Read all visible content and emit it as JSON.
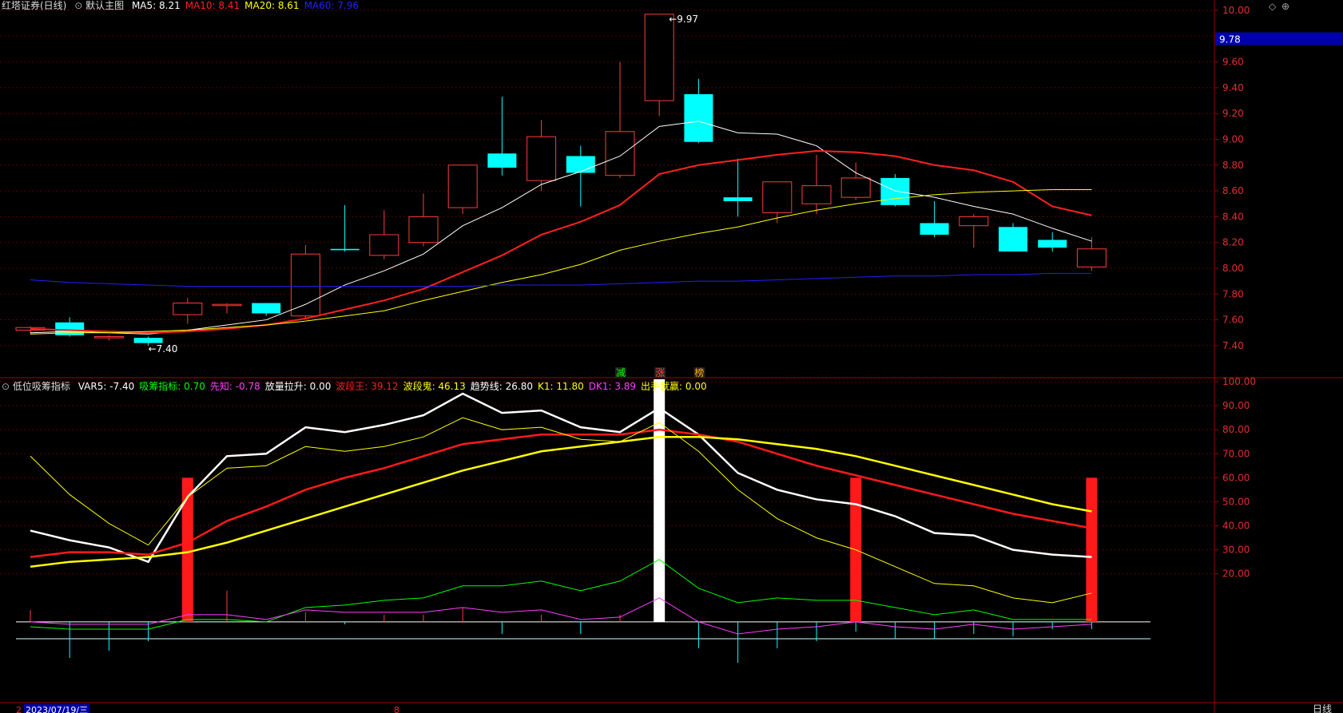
{
  "colors": {
    "up": "#ff3b3b",
    "down": "#00ffff",
    "ma5": "#ffffff",
    "ma10": "#ff2020",
    "ma20": "#ffff00",
    "ma60": "#2020ff",
    "axis": "#a00000",
    "grid": "#5a0000"
  },
  "header": {
    "stock": "红塔证券(日线)",
    "view": "默认主图",
    "ma": [
      {
        "label": "MA5: 8.21",
        "color": "#ffffff"
      },
      {
        "label": "MA10: 8.41",
        "color": "#ff2020"
      },
      {
        "label": "MA20: 8.61",
        "color": "#ffff00"
      },
      {
        "label": "MA60: 7.96",
        "color": "#2020ff"
      }
    ]
  },
  "indicator_header": {
    "name": "低位吸筹指标",
    "items": [
      {
        "label": "VAR5: -7.40",
        "color": "#ffffff"
      },
      {
        "label": "吸筹指标: 0.70",
        "color": "#00ff00"
      },
      {
        "label": "先知: -0.78",
        "color": "#ff40ff"
      },
      {
        "label": "放量拉升: 0.00",
        "color": "#ffffff"
      },
      {
        "label": "波段王: 39.12",
        "color": "#ff2020"
      },
      {
        "label": "波段鬼: 46.13",
        "color": "#ffff00"
      },
      {
        "label": "趋势线: 26.80",
        "color": "#ffffff"
      },
      {
        "label": "K1: 11.80",
        "color": "#ffff00"
      },
      {
        "label": "DK1: 3.89",
        "color": "#ff40ff"
      },
      {
        "label": "出手就赢: 0.00",
        "color": "#ffff00"
      }
    ]
  },
  "current_price": "9.78",
  "annotations": {
    "high": "9.97",
    "low": "7.40"
  },
  "signals": [
    {
      "label": "减",
      "color": "#00ff00",
      "index": 15
    },
    {
      "label": "涨",
      "color": "#ff4040",
      "index": 16
    },
    {
      "label": "榜",
      "color": "#ffaa00",
      "index": 17
    }
  ],
  "footer": {
    "date": "2023/07/19/三",
    "left_mark": "2",
    "mid_mark": "8",
    "period": "日线"
  },
  "chart_data": [
    {
      "type": "candlestick",
      "title": "",
      "ylim": [
        7.3,
        10.0
      ],
      "y_ticks": [
        "10.00",
        "9.80",
        "9.60",
        "9.40",
        "9.20",
        "9.00",
        "8.80",
        "8.60",
        "8.40",
        "8.20",
        "8.00",
        "7.80",
        "7.60",
        "7.40"
      ],
      "candles": [
        {
          "o": 7.52,
          "h": 7.55,
          "l": 7.49,
          "c": 7.54
        },
        {
          "o": 7.58,
          "h": 7.62,
          "l": 7.47,
          "c": 7.48
        },
        {
          "o": 7.46,
          "h": 7.48,
          "l": 7.44,
          "c": 7.47
        },
        {
          "o": 7.46,
          "h": 7.47,
          "l": 7.4,
          "c": 7.42
        },
        {
          "o": 7.64,
          "h": 7.77,
          "l": 7.57,
          "c": 7.73
        },
        {
          "o": 7.71,
          "h": 7.73,
          "l": 7.65,
          "c": 7.72
        },
        {
          "o": 7.73,
          "h": 7.73,
          "l": 7.63,
          "c": 7.65
        },
        {
          "o": 7.63,
          "h": 8.18,
          "l": 7.61,
          "c": 8.11
        },
        {
          "o": 8.15,
          "h": 8.49,
          "l": 8.13,
          "c": 8.14
        },
        {
          "o": 8.1,
          "h": 8.45,
          "l": 8.07,
          "c": 8.26
        },
        {
          "o": 8.2,
          "h": 8.58,
          "l": 8.17,
          "c": 8.4
        },
        {
          "o": 8.47,
          "h": 8.8,
          "l": 8.42,
          "c": 8.8
        },
        {
          "o": 8.89,
          "h": 9.33,
          "l": 8.72,
          "c": 8.78
        },
        {
          "o": 8.68,
          "h": 9.15,
          "l": 8.6,
          "c": 9.02
        },
        {
          "o": 8.87,
          "h": 8.95,
          "l": 8.48,
          "c": 8.74
        },
        {
          "o": 8.72,
          "h": 9.6,
          "l": 8.7,
          "c": 9.06
        },
        {
          "o": 9.3,
          "h": 9.97,
          "l": 9.18,
          "c": 9.97
        },
        {
          "o": 9.35,
          "h": 9.47,
          "l": 8.97,
          "c": 8.98
        },
        {
          "o": 8.55,
          "h": 8.85,
          "l": 8.4,
          "c": 8.52
        },
        {
          "o": 8.43,
          "h": 8.67,
          "l": 8.35,
          "c": 8.67
        },
        {
          "o": 8.5,
          "h": 8.88,
          "l": 8.42,
          "c": 8.64
        },
        {
          "o": 8.55,
          "h": 8.82,
          "l": 8.53,
          "c": 8.7
        },
        {
          "o": 8.7,
          "h": 8.73,
          "l": 8.48,
          "c": 8.49
        },
        {
          "o": 8.35,
          "h": 8.52,
          "l": 8.24,
          "c": 8.26
        },
        {
          "o": 8.33,
          "h": 8.42,
          "l": 8.16,
          "c": 8.4
        },
        {
          "o": 8.32,
          "h": 8.35,
          "l": 8.13,
          "c": 8.13
        },
        {
          "o": 8.22,
          "h": 8.28,
          "l": 8.13,
          "c": 8.16
        },
        {
          "o": 8.01,
          "h": 8.24,
          "l": 7.98,
          "c": 8.15
        }
      ],
      "series": [
        {
          "name": "MA5",
          "values": [
            7.5,
            7.51,
            7.5,
            7.49,
            7.52,
            7.56,
            7.6,
            7.72,
            7.87,
            7.98,
            8.11,
            8.33,
            8.47,
            8.65,
            8.75,
            8.87,
            9.1,
            9.14,
            9.05,
            9.04,
            8.95,
            8.74,
            8.6,
            8.55,
            8.48,
            8.42,
            8.31,
            8.21
          ]
        },
        {
          "name": "MA10",
          "values": [
            7.53,
            7.52,
            7.51,
            7.5,
            7.51,
            7.53,
            7.56,
            7.61,
            7.68,
            7.75,
            7.84,
            7.97,
            8.1,
            8.26,
            8.36,
            8.49,
            8.73,
            8.8,
            8.84,
            8.88,
            8.91,
            8.9,
            8.87,
            8.8,
            8.76,
            8.67,
            8.48,
            8.41
          ]
        },
        {
          "name": "MA20",
          "values": [
            7.49,
            7.5,
            7.5,
            7.51,
            7.52,
            7.54,
            7.56,
            7.59,
            7.63,
            7.67,
            7.75,
            7.82,
            7.89,
            7.95,
            8.03,
            8.14,
            8.21,
            8.27,
            8.32,
            8.39,
            8.45,
            8.5,
            8.54,
            8.57,
            8.59,
            8.6,
            8.61,
            8.61
          ]
        },
        {
          "name": "MA60",
          "values": [
            7.91,
            7.89,
            7.88,
            7.87,
            7.86,
            7.86,
            7.86,
            7.86,
            7.86,
            7.86,
            7.86,
            7.86,
            7.87,
            7.87,
            7.87,
            7.88,
            7.89,
            7.9,
            7.9,
            7.91,
            7.92,
            7.93,
            7.94,
            7.94,
            7.95,
            7.95,
            7.96,
            7.96
          ]
        }
      ]
    },
    {
      "type": "line",
      "title": "",
      "ylim": [
        -8,
        100
      ],
      "y_ticks": [
        "100.00",
        "90.00",
        "80.00",
        "70.00",
        "60.00",
        "50.00",
        "40.00",
        "30.00",
        "20.00"
      ],
      "series": [
        {
          "name": "趋势线",
          "color": "#ffffff",
          "width": 2.5,
          "values": [
            38,
            34,
            31,
            25,
            52,
            69,
            70,
            81,
            79,
            82,
            86,
            95,
            87,
            88,
            81,
            79,
            89,
            78,
            62,
            55,
            51,
            49,
            44,
            37,
            36,
            30,
            28,
            27
          ]
        },
        {
          "name": "波段王",
          "color": "#ff1a1a",
          "width": 2.5,
          "values": [
            27,
            29,
            29,
            28,
            33,
            42,
            48,
            55,
            60,
            64,
            69,
            74,
            76,
            78,
            78,
            78,
            80,
            78,
            75,
            70,
            65,
            61,
            57,
            53,
            49,
            45,
            42,
            39
          ]
        },
        {
          "name": "波段鬼",
          "color": "#ffff00",
          "width": 2.5,
          "values": [
            23,
            25,
            26,
            27,
            29,
            33,
            38,
            43,
            48,
            53,
            58,
            63,
            67,
            71,
            73,
            75,
            77,
            77,
            76,
            74,
            72,
            69,
            65,
            61,
            57,
            53,
            49,
            46
          ]
        },
        {
          "name": "K1",
          "color": "#ffff00",
          "width": 1,
          "values": [
            69,
            53,
            41,
            32,
            52,
            64,
            65,
            73,
            71,
            73,
            77,
            85,
            80,
            81,
            76,
            75,
            83,
            71,
            55,
            43,
            35,
            30,
            23,
            16,
            15,
            10,
            8,
            12
          ]
        },
        {
          "name": "吸筹指标",
          "color": "#00ff00",
          "width": 1,
          "values": [
            -2,
            -3,
            -3,
            -3,
            1,
            1,
            0,
            6,
            7,
            9,
            10,
            15,
            15,
            17,
            13,
            17,
            26,
            14,
            8,
            10,
            9,
            9,
            6,
            3,
            5,
            1,
            1,
            1
          ]
        },
        {
          "name": "先知",
          "color": "#ff40ff",
          "width": 1,
          "values": [
            0,
            -1,
            -1,
            -1,
            3,
            3,
            1,
            5,
            4,
            4,
            4,
            6,
            4,
            5,
            1,
            2,
            10,
            0,
            -5,
            -3,
            -2,
            0,
            -2,
            -3,
            -1,
            -3,
            -2,
            -1
          ]
        },
        {
          "name": "DK1",
          "color": "#ffffff",
          "width": 1,
          "values": [
            0,
            0,
            0,
            0,
            0,
            0,
            0,
            0,
            0,
            0,
            0,
            0,
            0,
            0,
            0,
            0,
            0,
            0,
            0,
            0,
            0,
            0,
            0,
            0,
            0,
            0,
            0,
            0
          ]
        }
      ],
      "white_bars": [
        {
          "index": 16,
          "top": 101,
          "bottom": 0
        }
      ],
      "red_bars": [
        {
          "index": 4,
          "top": 60,
          "bottom": 0
        },
        {
          "index": 21,
          "top": 60,
          "bottom": 0
        },
        {
          "index": 27,
          "top": 60,
          "bottom": 0
        }
      ],
      "spikes": [
        {
          "index": 0,
          "value": 5,
          "color": "#ff3b3b"
        },
        {
          "index": 1,
          "value": -15,
          "color": "#00ffff"
        },
        {
          "index": 2,
          "value": -12,
          "color": "#00ffff"
        },
        {
          "index": 3,
          "value": -8,
          "color": "#00ffff"
        },
        {
          "index": 4,
          "value": 19,
          "color": "#ff3b3b"
        },
        {
          "index": 5,
          "value": 13,
          "color": "#ff3b3b"
        },
        {
          "index": 7,
          "value": 4,
          "color": "#ff3b3b"
        },
        {
          "index": 8,
          "value": -1,
          "color": "#00ffff"
        },
        {
          "index": 9,
          "value": 3,
          "color": "#ff3b3b"
        },
        {
          "index": 10,
          "value": 3,
          "color": "#ff3b3b"
        },
        {
          "index": 11,
          "value": 6,
          "color": "#ff3b3b"
        },
        {
          "index": 12,
          "value": -5,
          "color": "#00ffff"
        },
        {
          "index": 13,
          "value": 3,
          "color": "#ff3b3b"
        },
        {
          "index": 14,
          "value": -5,
          "color": "#00ffff"
        },
        {
          "index": 15,
          "value": 3,
          "color": "#ff3b3b"
        },
        {
          "index": 16,
          "value": 10,
          "color": "#ff3b3b"
        },
        {
          "index": 17,
          "value": -11,
          "color": "#00ffff"
        },
        {
          "index": 18,
          "value": -17,
          "color": "#00ffff"
        },
        {
          "index": 19,
          "value": -11,
          "color": "#00ffff"
        },
        {
          "index": 20,
          "value": -8,
          "color": "#00ffff"
        },
        {
          "index": 21,
          "value": -4,
          "color": "#00ffff"
        },
        {
          "index": 22,
          "value": -7,
          "color": "#00ffff"
        },
        {
          "index": 23,
          "value": -7,
          "color": "#00ffff"
        },
        {
          "index": 24,
          "value": -5,
          "color": "#00ffff"
        },
        {
          "index": 25,
          "value": -6,
          "color": "#00ffff"
        },
        {
          "index": 26,
          "value": -3,
          "color": "#00ffff"
        },
        {
          "index": 27,
          "value": -3,
          "color": "#00ffff"
        }
      ]
    }
  ]
}
